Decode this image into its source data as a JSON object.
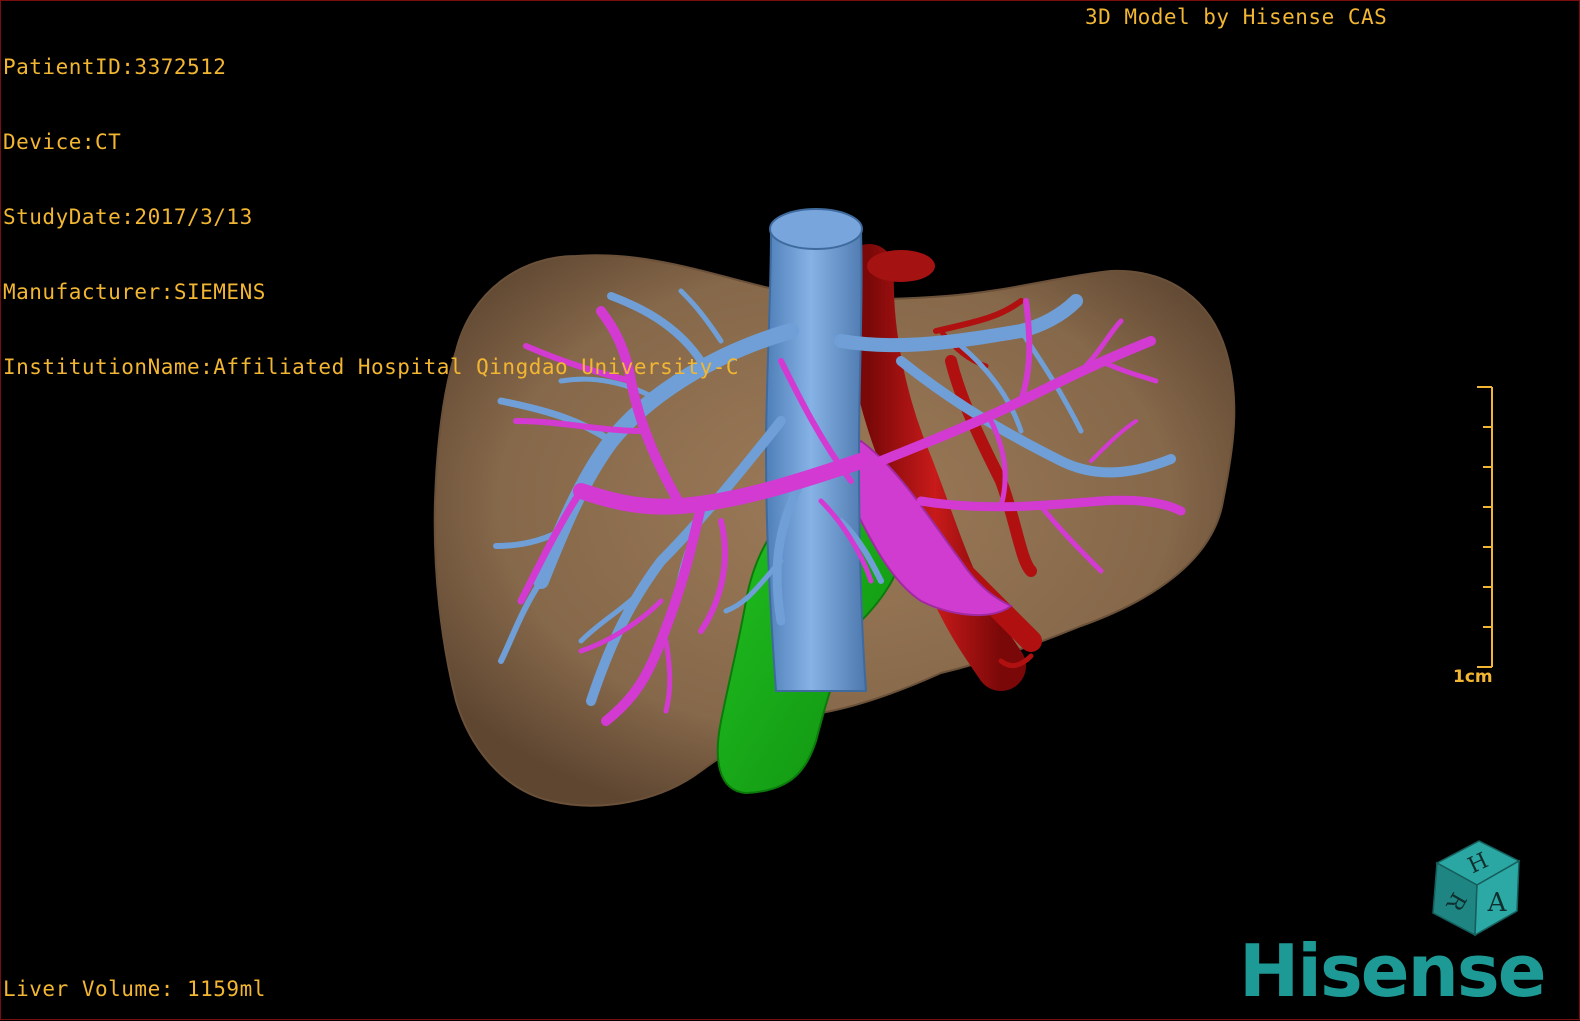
{
  "header": {
    "patient_id": "PatientID:3372512",
    "device": "Device:CT",
    "study_date": "StudyDate:2017/3/13",
    "manufacturer": "Manufacturer:SIEMENS",
    "institution": "InstitutionName:Affiliated Hospital Qingdao University-C",
    "model_credit": "3D Model by Hisense CAS"
  },
  "footer": {
    "liver_volume": "Liver Volume: 1159ml"
  },
  "scale_bar": {
    "label": "1cm"
  },
  "orientation_cube": {
    "faces": [
      "H",
      "R",
      "A"
    ]
  },
  "brand": {
    "logo_text": "Hisense"
  },
  "colors": {
    "overlay_text": "#f2b632",
    "liver": "#8a6a4a",
    "hepatic_vein_ivc": "#6f9fd6",
    "portal_vein": "#d23ad2",
    "artery_aorta": "#b01010",
    "gallbladder": "#16b016",
    "brand": "#1e9a96",
    "border": "#7a0e0e"
  },
  "structures": [
    "liver",
    "inferior-vena-cava",
    "hepatic-veins",
    "portal-veins",
    "aorta",
    "hepatic-artery",
    "gallbladder"
  ]
}
